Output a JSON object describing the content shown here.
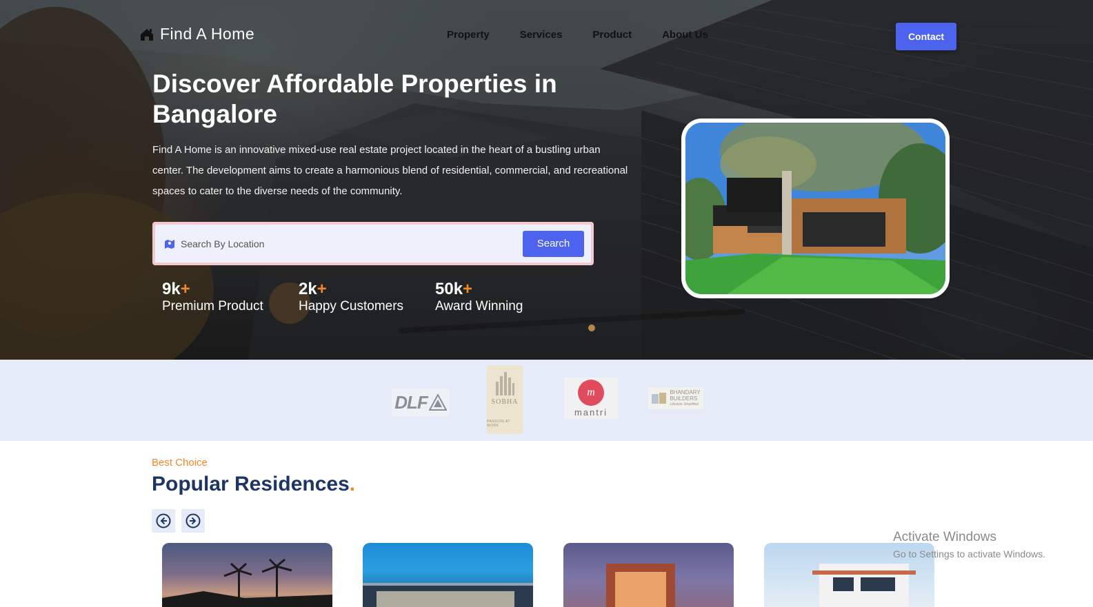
{
  "nav": {
    "brand": "Find A Home",
    "brand_icon": "house-icon",
    "links": [
      "Property",
      "Services",
      "Product",
      "About Us"
    ],
    "contact_label": "Contact"
  },
  "hero": {
    "title": "Discover Affordable Properties in Bangalore",
    "description": "Find A Home is an innovative mixed-use real estate project located in the heart of a bustling urban center. The development aims to create a harmonious blend of residential, commercial, and recreational spaces to cater to the diverse needs of the community.",
    "search": {
      "placeholder": "Search By Location",
      "icon": "map-location-icon",
      "button_label": "Search"
    },
    "stats": [
      {
        "value": "9k",
        "plus": "+",
        "label": "Premium Product"
      },
      {
        "value": "2k",
        "plus": "+",
        "label": "Happy Customers"
      },
      {
        "value": "50k",
        "plus": "+",
        "label": "Award Winning"
      }
    ]
  },
  "partners": {
    "dlf": "DLF",
    "sobha": "SOBHA",
    "sobha_tagline": "PASSION AT WORK",
    "mantri": "mantri",
    "bhandary_line1": "BHANDARY",
    "bhandary_line2": "BUILDERS",
    "bhandary_line3": "Lifestyle Simplified"
  },
  "popular": {
    "eyebrow": "Best Choice",
    "title": "Popular Residences",
    "title_dot": ".",
    "prev_icon": "arrow-left-circle-icon",
    "next_icon": "arrow-right-circle-icon"
  },
  "watermark": {
    "title": "Activate Windows",
    "subtitle": "Go to Settings to activate Windows."
  },
  "colors": {
    "accent_blue": "#4d63ee",
    "accent_orange": "#f5872a",
    "heading_navy": "#1d3566",
    "strip_bg": "#e5ecf8"
  }
}
